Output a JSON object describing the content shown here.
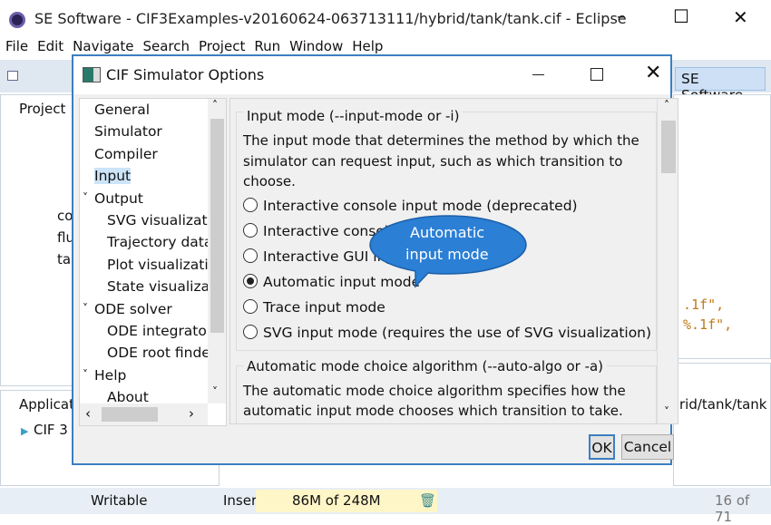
{
  "window": {
    "title": "SE Software - CIF3Examples-v20160624-063713111/hybrid/tank/tank.cif - Eclipse",
    "controls": [
      "–",
      "☐",
      "✕"
    ]
  },
  "menu": [
    "File",
    "Edit",
    "Navigate",
    "Search",
    "Project",
    "Run",
    "Window",
    "Help"
  ],
  "perspective": "SE Software",
  "project_view": {
    "title": "Project",
    "items": [
      "co",
      "flu",
      "tar"
    ]
  },
  "app_view": {
    "title": "Applicat",
    "item": "CIF 3"
  },
  "editor": {
    "line1": ".1f\",",
    "line2": "%.1f\","
  },
  "console": {
    "path": "rid/tank/tank"
  },
  "status": {
    "writable": "Writable",
    "insert": "Inser",
    "memory": "86M of 248M",
    "page": "16 of 71"
  },
  "dialog": {
    "title": "CIF Simulator Options",
    "tree": [
      {
        "label": "General",
        "level": 0
      },
      {
        "label": "Simulator",
        "level": 0
      },
      {
        "label": "Compiler",
        "level": 0
      },
      {
        "label": "Input",
        "level": 0,
        "selected": true
      },
      {
        "label": "Output",
        "level": 0,
        "expanded": true
      },
      {
        "label": "SVG visualizatio",
        "level": 1
      },
      {
        "label": "Trajectory data",
        "level": 1
      },
      {
        "label": "Plot visualizatio",
        "level": 1
      },
      {
        "label": "State visualizat",
        "level": 1
      },
      {
        "label": "ODE solver",
        "level": 0,
        "expanded": true
      },
      {
        "label": "ODE integrator",
        "level": 1
      },
      {
        "label": "ODE root finder",
        "level": 1
      },
      {
        "label": "Help",
        "level": 0,
        "expanded": true
      },
      {
        "label": "About",
        "level": 1
      }
    ],
    "input_group": {
      "title": "Input mode (--input-mode or -i)",
      "desc": [
        "The input mode that determines the method by which the",
        "simulator can request input, such as which transition to",
        "choose."
      ],
      "options": [
        {
          "label": "Interactive console input mode (deprecated)",
          "selected": false
        },
        {
          "label": "Interactive console input mode",
          "selected": false
        },
        {
          "label": "Interactive GUI input mode",
          "selected": false
        },
        {
          "label": "Automatic input mode",
          "selected": true
        },
        {
          "label": "Trace input mode",
          "selected": false
        },
        {
          "label": "SVG input mode (requires the use of SVG visualization)",
          "selected": false
        }
      ]
    },
    "auto_group": {
      "title": "Automatic mode choice algorithm (--auto-algo or -a)",
      "desc": [
        "The automatic mode choice algorithm specifies how the",
        "automatic input mode chooses which transition to take."
      ]
    },
    "ok": "OK",
    "cancel": "Cancel"
  },
  "callout": {
    "text": [
      "Automatic",
      "input mode"
    ],
    "color": "#2b7fd4"
  }
}
